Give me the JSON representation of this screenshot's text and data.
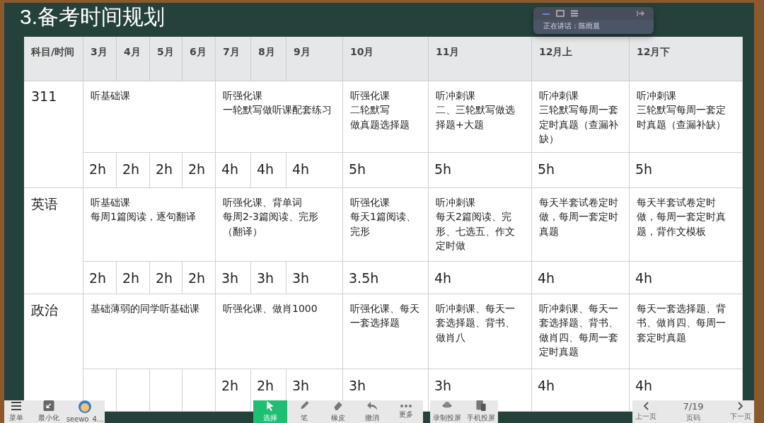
{
  "slide": {
    "title": "3.备考时间规划"
  },
  "table": {
    "columns": [
      "科目/时间",
      "3月",
      "4月",
      "5月",
      "6月",
      "7月",
      "8月",
      "9月",
      "10月",
      "11月",
      "12月上",
      "12月下"
    ],
    "rows": [
      {
        "subject": "311",
        "plans": [
          [
            "听基础课"
          ],
          [
            "听强化课",
            "一轮默写做听课配套练习"
          ],
          [
            "听强化课",
            "二轮默写",
            "做真题选择题"
          ],
          [
            "听冲刺课",
            "二、三轮默写做选择题+大题"
          ],
          [
            "听冲刺课",
            "三轮默写每周一套定时真题（查漏补缺）"
          ],
          [
            "听冲刺课",
            "三轮默写每周一套定时真题（查漏补缺）"
          ]
        ],
        "hours": [
          "2h",
          "2h",
          "2h",
          "2h",
          "4h",
          "4h",
          "4h",
          "5h",
          "5h",
          "5h",
          "5h"
        ]
      },
      {
        "subject": "英语",
        "plans": [
          [
            "听基础课",
            "每周1篇阅读，逐句翻译"
          ],
          [
            "听强化课、背单词",
            "每周2-3篇阅读、完形（翻译）"
          ],
          [
            "听强化课",
            "每天1篇阅读、完形"
          ],
          [
            "听冲刺课",
            "每天2篇阅读、完形、七选五、作文定时做"
          ],
          [
            "每天半套试卷定时做，每周一套定时真题"
          ],
          [
            "每天半套试卷定时做，每周一套定时真题，背作文模板"
          ]
        ],
        "hours": [
          "2h",
          "2h",
          "2h",
          "2h",
          "3h",
          "3h",
          "3h",
          "3.5h",
          "4h",
          "4h",
          "4h"
        ]
      },
      {
        "subject": "政治",
        "plans": [
          [
            "基础薄弱的同学听基础课"
          ],
          [
            "听强化课、做肖1000"
          ],
          [
            "听强化课、每天一套选择题"
          ],
          [
            "听冲刺课、每天一套选择题、背书、做肖八"
          ],
          [
            "听冲刺课、每天一套选择题、背书、做肖四、每周一套定时真题"
          ],
          [
            "每天一套选择题、背书、做肖四、每周一套定时真题"
          ]
        ],
        "hours": [
          "2h",
          "2h",
          "3h",
          "3h",
          "3h",
          "4h",
          "4h"
        ]
      }
    ]
  },
  "call_panel": {
    "status": "正在讲话：陈雨晨"
  },
  "toolbar": {
    "left": [
      {
        "label": "菜单"
      },
      {
        "label": "最小化"
      },
      {
        "label": "seewo_4..."
      }
    ],
    "tools": [
      {
        "label": "选择",
        "selected": true
      },
      {
        "label": "笔",
        "selected": false
      },
      {
        "label": "橡皮",
        "selected": false
      },
      {
        "label": "撤消",
        "selected": false
      },
      {
        "label": "更多",
        "selected": false
      }
    ],
    "share": [
      {
        "label": "录制投屏"
      },
      {
        "label": "手机投屏"
      }
    ],
    "pager": {
      "prev": "上一页",
      "page": "7/19",
      "page_label": "页码",
      "next": "下一页"
    }
  }
}
